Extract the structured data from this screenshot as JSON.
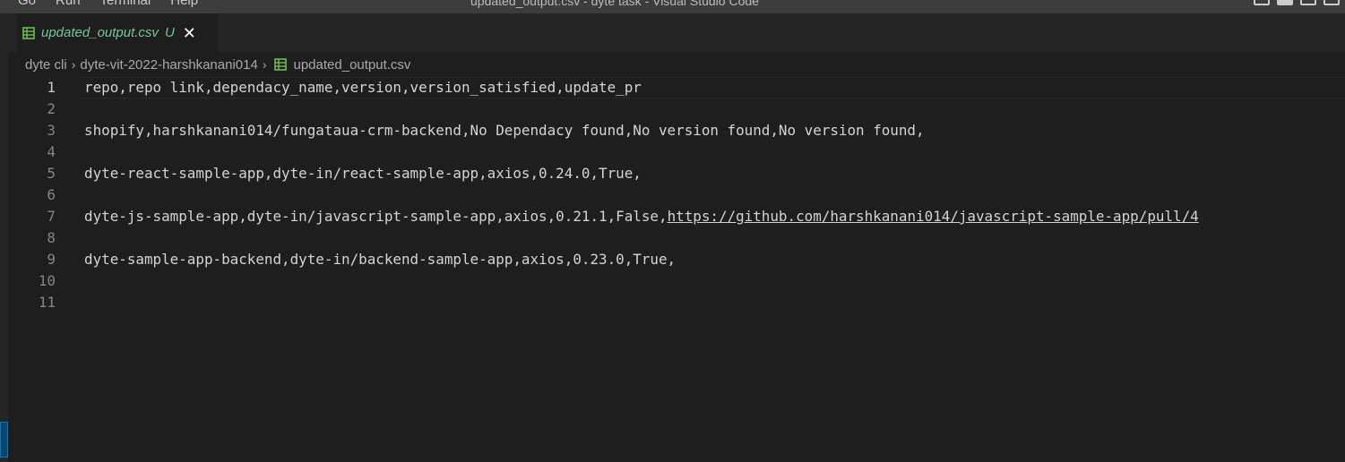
{
  "menu": [
    "Go",
    "Run",
    "Terminal",
    "Help"
  ],
  "window_title": "updated_output.csv - dyte task - Visual Studio Code",
  "tab": {
    "label": "updated_output.csv",
    "status": "U",
    "close": "✕"
  },
  "breadcrumb": {
    "items": [
      "dyte cli",
      "dyte-vit-2022-harshkanani014",
      "updated_output.csv"
    ],
    "separator": "›"
  },
  "editor": {
    "active_line": 1,
    "lines": [
      {
        "number": "1",
        "pre": "repo,repo link,dependacy_name,version,version_satisfied,update_pr",
        "link": "",
        "post": ""
      },
      {
        "number": "2",
        "pre": "",
        "link": "",
        "post": ""
      },
      {
        "number": "3",
        "pre": "shopify,harshkanani014/fungataua-crm-backend,No Dependacy found,No version found,No version found,",
        "link": "",
        "post": ""
      },
      {
        "number": "4",
        "pre": "",
        "link": "",
        "post": ""
      },
      {
        "number": "5",
        "pre": "dyte-react-sample-app,dyte-in/react-sample-app,axios,0.24.0,True,",
        "link": "",
        "post": ""
      },
      {
        "number": "6",
        "pre": "",
        "link": "",
        "post": ""
      },
      {
        "number": "7",
        "pre": "dyte-js-sample-app,dyte-in/javascript-sample-app,axios,0.21.1,False,",
        "link": "https://github.com/harshkanani014/javascript-sample-app/pull/4",
        "post": ""
      },
      {
        "number": "8",
        "pre": "",
        "link": "",
        "post": ""
      },
      {
        "number": "9",
        "pre": "dyte-sample-app-backend,dyte-in/backend-sample-app,axios,0.23.0,True,",
        "link": "",
        "post": ""
      },
      {
        "number": "10",
        "pre": "",
        "link": "",
        "post": ""
      },
      {
        "number": "11",
        "pre": "",
        "link": "",
        "post": ""
      }
    ]
  },
  "colors": {
    "editor_bg": "#1e1e1e",
    "tab_modified": "#73c991",
    "csv_icon": "#6fbf4a",
    "text": "#d4d4d4",
    "line_number": "#858585"
  },
  "icons": {
    "file": "csv-file-icon",
    "close": "close-icon",
    "chevron": "chevron-right-icon"
  }
}
